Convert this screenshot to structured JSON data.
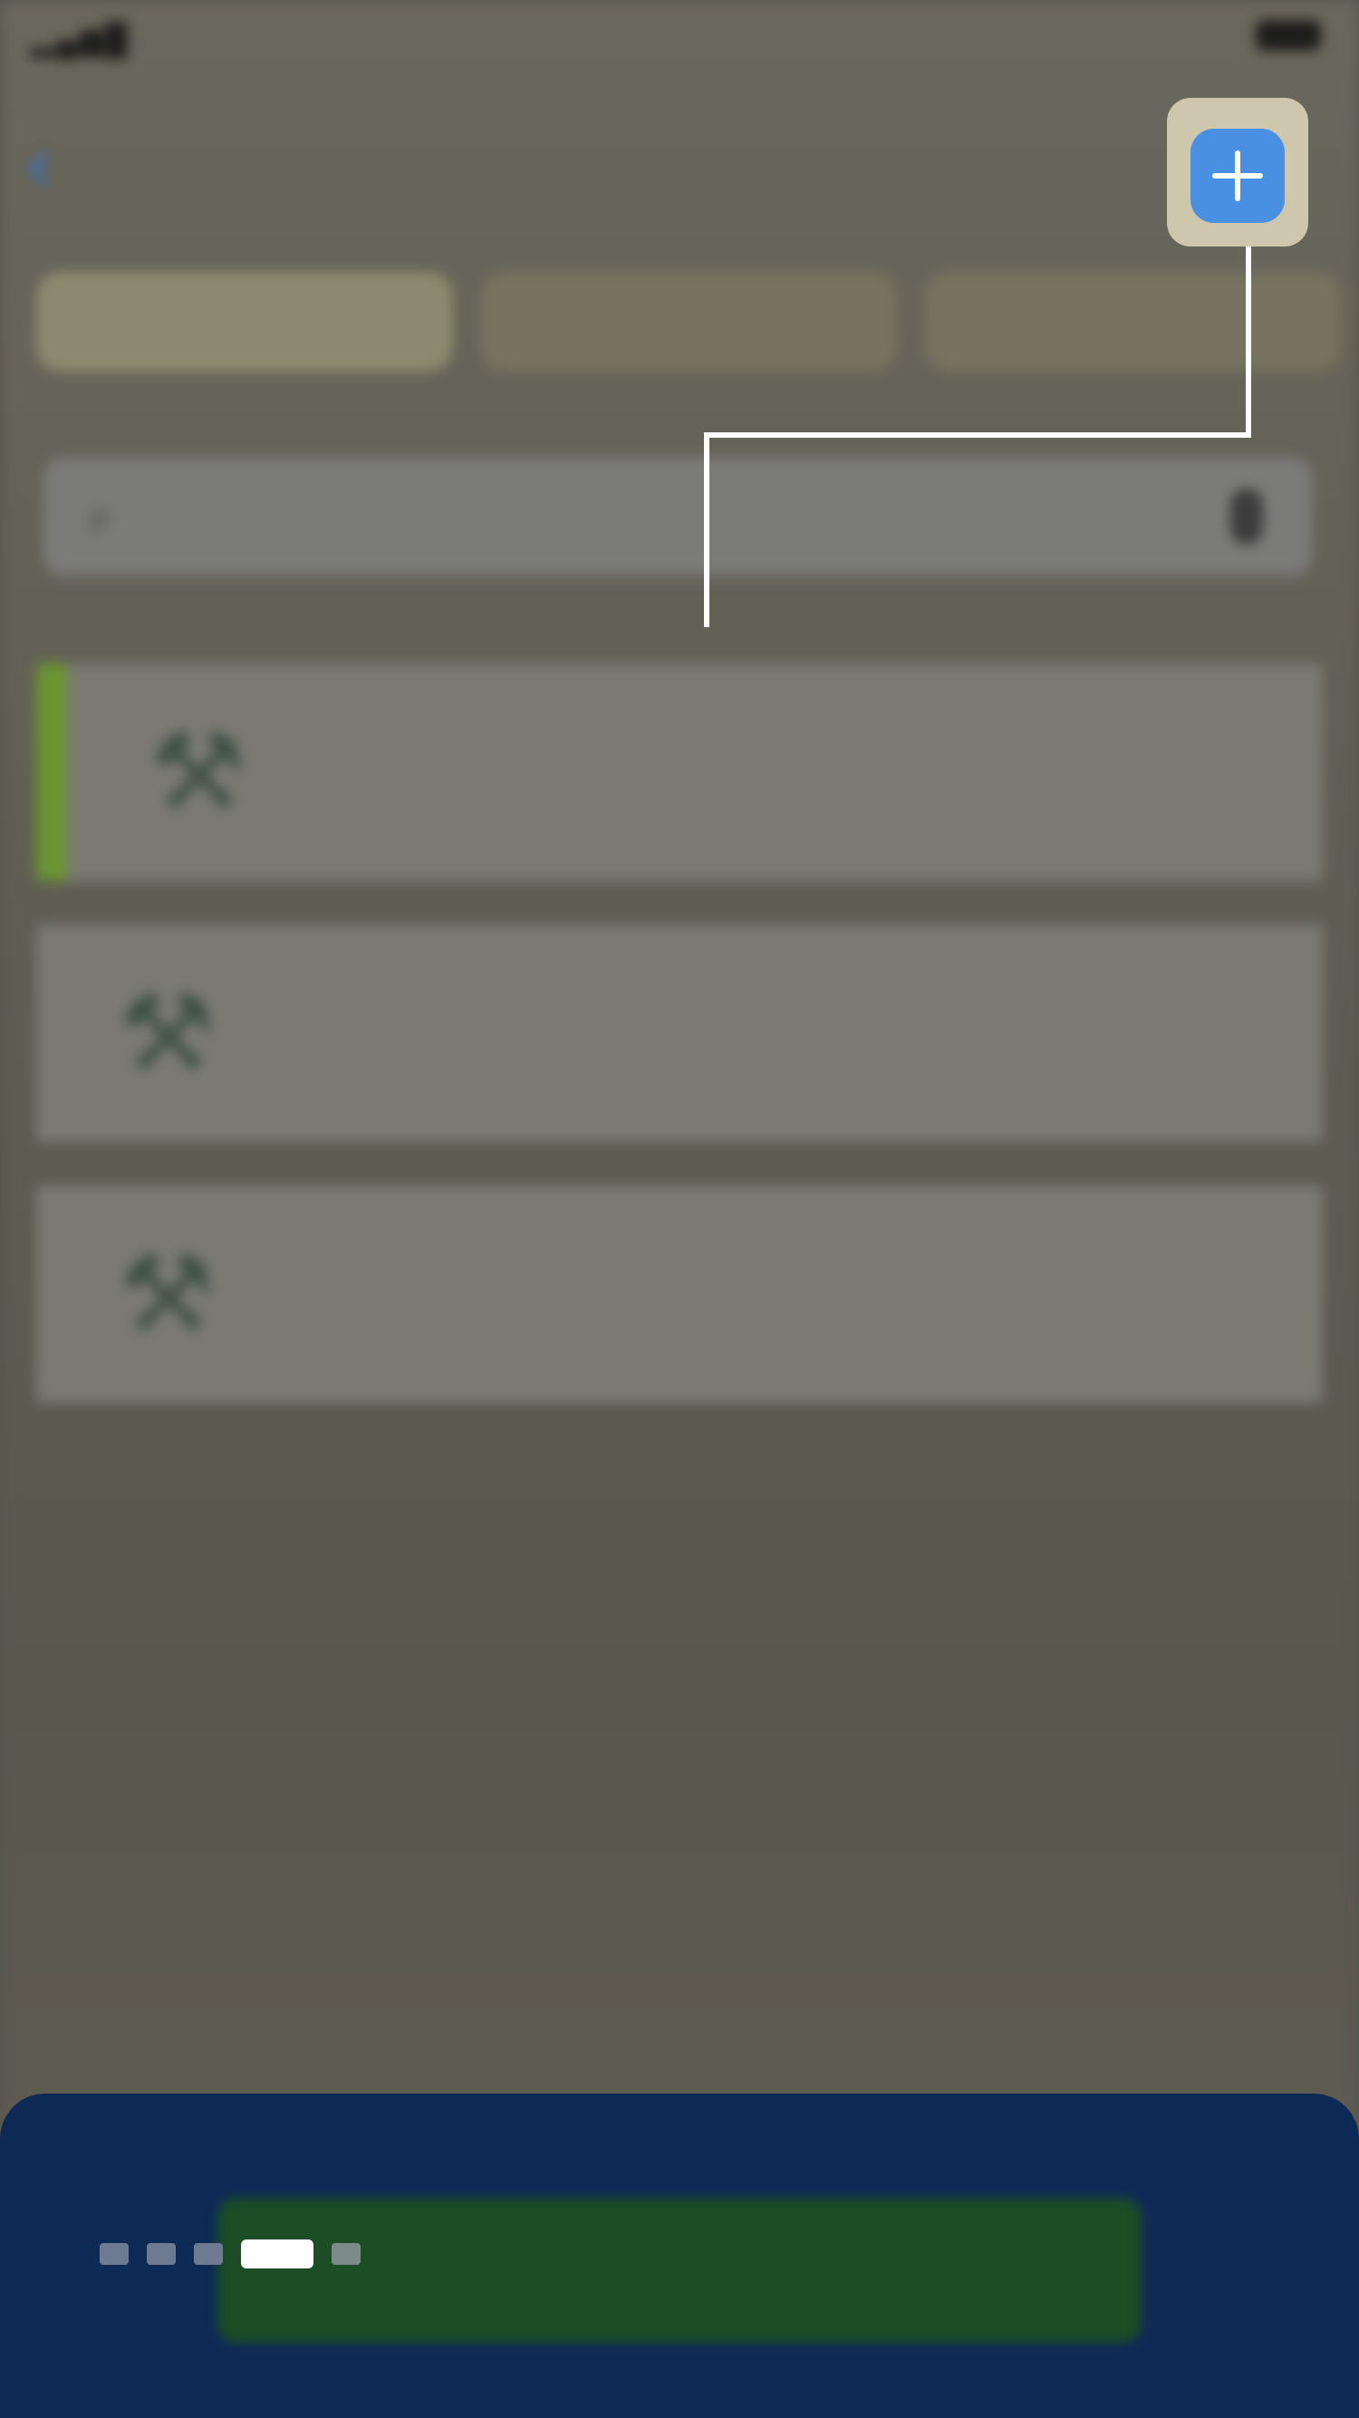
{
  "status_bar": {
    "carrier": "",
    "time": "",
    "battery": ""
  },
  "nav": {
    "back_label": "",
    "title": ""
  },
  "tabs": [
    {
      "label": ""
    },
    {
      "label": ""
    },
    {
      "label": ""
    }
  ],
  "search": {
    "placeholder": ""
  },
  "items": [
    {
      "title": "",
      "subtitle": "",
      "qty": "",
      "price": ""
    },
    {
      "title": "",
      "subtitle": "",
      "qty": "",
      "price": ""
    },
    {
      "title": "",
      "subtitle": "",
      "qty": "",
      "price": ""
    }
  ],
  "bottom_sheet": {
    "heading": "",
    "button_label": ""
  },
  "tour": {
    "step_count": 5,
    "current_step": 4,
    "icon": "plus-icon"
  },
  "colors": {
    "accent_blue": "#4a90e2",
    "highlight_green": "#6a9632",
    "sheet_navy": "#0d2a57",
    "spotlight": "#cfc6ae"
  }
}
